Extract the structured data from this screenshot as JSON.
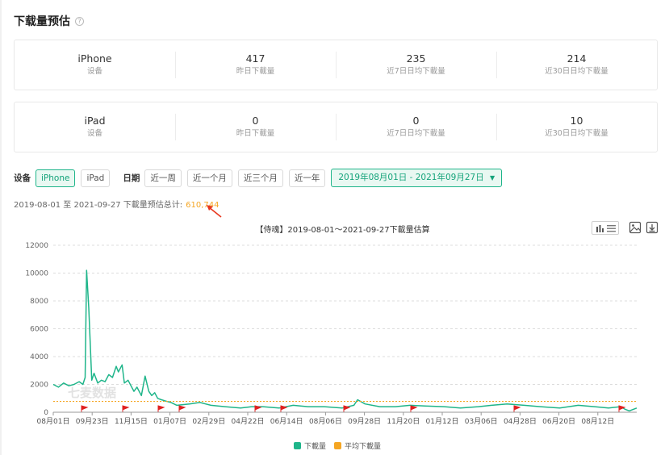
{
  "title": "下载量预估",
  "iphone": {
    "device": "iPhone",
    "device_label": "设备",
    "stats": [
      {
        "value": "417",
        "label": "昨日下載量"
      },
      {
        "value": "235",
        "label": "近7日日均下載量"
      },
      {
        "value": "214",
        "label": "近30日日均下載量"
      }
    ]
  },
  "ipad": {
    "device": "iPad",
    "device_label": "设备",
    "stats": [
      {
        "value": "0",
        "label": "昨日下載量"
      },
      {
        "value": "0",
        "label": "近7日日均下載量"
      },
      {
        "value": "10",
        "label": "近30日日均下載量"
      }
    ]
  },
  "filters": {
    "device_label": "设备",
    "devices": [
      "iPhone",
      "iPad"
    ],
    "date_label": "日期",
    "ranges": [
      "近一周",
      "近一个月",
      "近三个月",
      "近一年"
    ],
    "selected_range": "2019年08月01日 - 2021年09月27日"
  },
  "total": {
    "text": "2019-08-01 至 2021-09-27 下載量预估总计:",
    "value": "610,744"
  },
  "colors": {
    "primary": "#1fb58a",
    "average": "#f5a623"
  },
  "chart_data": {
    "type": "line",
    "title": "【侍魂】2019-08-01～2021-09-27下載量估算",
    "x_ticks": [
      "08月01日",
      "09月23日",
      "11月15日",
      "01月07日",
      "02月29日",
      "04月22日",
      "06月14日",
      "08月06日",
      "09月28日",
      "11月20日",
      "01月12日",
      "03月06日",
      "04月28日",
      "06月20日",
      "08月12日"
    ],
    "ylim": [
      0,
      12000
    ],
    "y_ticks": [
      "0",
      "2000",
      "4000",
      "6000",
      "8000",
      "10000",
      "12000"
    ],
    "grid": true,
    "series": [
      {
        "name": "下載量",
        "x": [
          "2019-08-01",
          "2019-08-08",
          "2019-08-15",
          "2019-08-22",
          "2019-08-29",
          "2019-09-05",
          "2019-09-10",
          "2019-09-13",
          "2019-09-15",
          "2019-09-18",
          "2019-09-22",
          "2019-09-25",
          "2019-09-30",
          "2019-10-05",
          "2019-10-10",
          "2019-10-15",
          "2019-10-20",
          "2019-10-25",
          "2019-10-28",
          "2019-11-02",
          "2019-11-05",
          "2019-11-10",
          "2019-11-14",
          "2019-11-18",
          "2019-11-22",
          "2019-11-28",
          "2019-12-03",
          "2019-12-08",
          "2019-12-12",
          "2019-12-16",
          "2019-12-20",
          "2019-12-25",
          "2019-12-31",
          "2020-01-07",
          "2020-01-15",
          "2020-02-01",
          "2020-02-15",
          "2020-03-01",
          "2020-03-20",
          "2020-04-10",
          "2020-04-25",
          "2020-05-10",
          "2020-06-01",
          "2020-06-20",
          "2020-07-10",
          "2020-08-01",
          "2020-08-25",
          "2020-09-10",
          "2020-09-15",
          "2020-09-25",
          "2020-10-15",
          "2020-11-05",
          "2020-11-25",
          "2020-12-15",
          "2021-01-10",
          "2021-02-01",
          "2021-02-25",
          "2021-03-15",
          "2021-04-05",
          "2021-04-28",
          "2021-05-20",
          "2021-06-15",
          "2021-07-10",
          "2021-08-01",
          "2021-08-20",
          "2021-09-05",
          "2021-09-12",
          "2021-09-17",
          "2021-09-22",
          "2021-09-27"
        ],
        "values": [
          2000,
          1800,
          2100,
          1900,
          2000,
          2200,
          2000,
          2500,
          10200,
          7500,
          2300,
          2800,
          2100,
          2300,
          2200,
          2700,
          2500,
          3300,
          2900,
          3400,
          2100,
          2300,
          1900,
          1500,
          1800,
          1200,
          2600,
          1500,
          1200,
          1400,
          1000,
          900,
          800,
          700,
          500,
          600,
          700,
          500,
          400,
          300,
          400,
          400,
          300,
          500,
          400,
          400,
          300,
          500,
          900,
          600,
          400,
          400,
          500,
          450,
          400,
          300,
          400,
          500,
          600,
          500,
          400,
          300,
          500,
          400,
          300,
          400,
          200,
          100,
          200,
          300
        ]
      },
      {
        "name": "平均下載量",
        "values": [
          780
        ]
      }
    ],
    "legend_position": "bottom-center"
  }
}
